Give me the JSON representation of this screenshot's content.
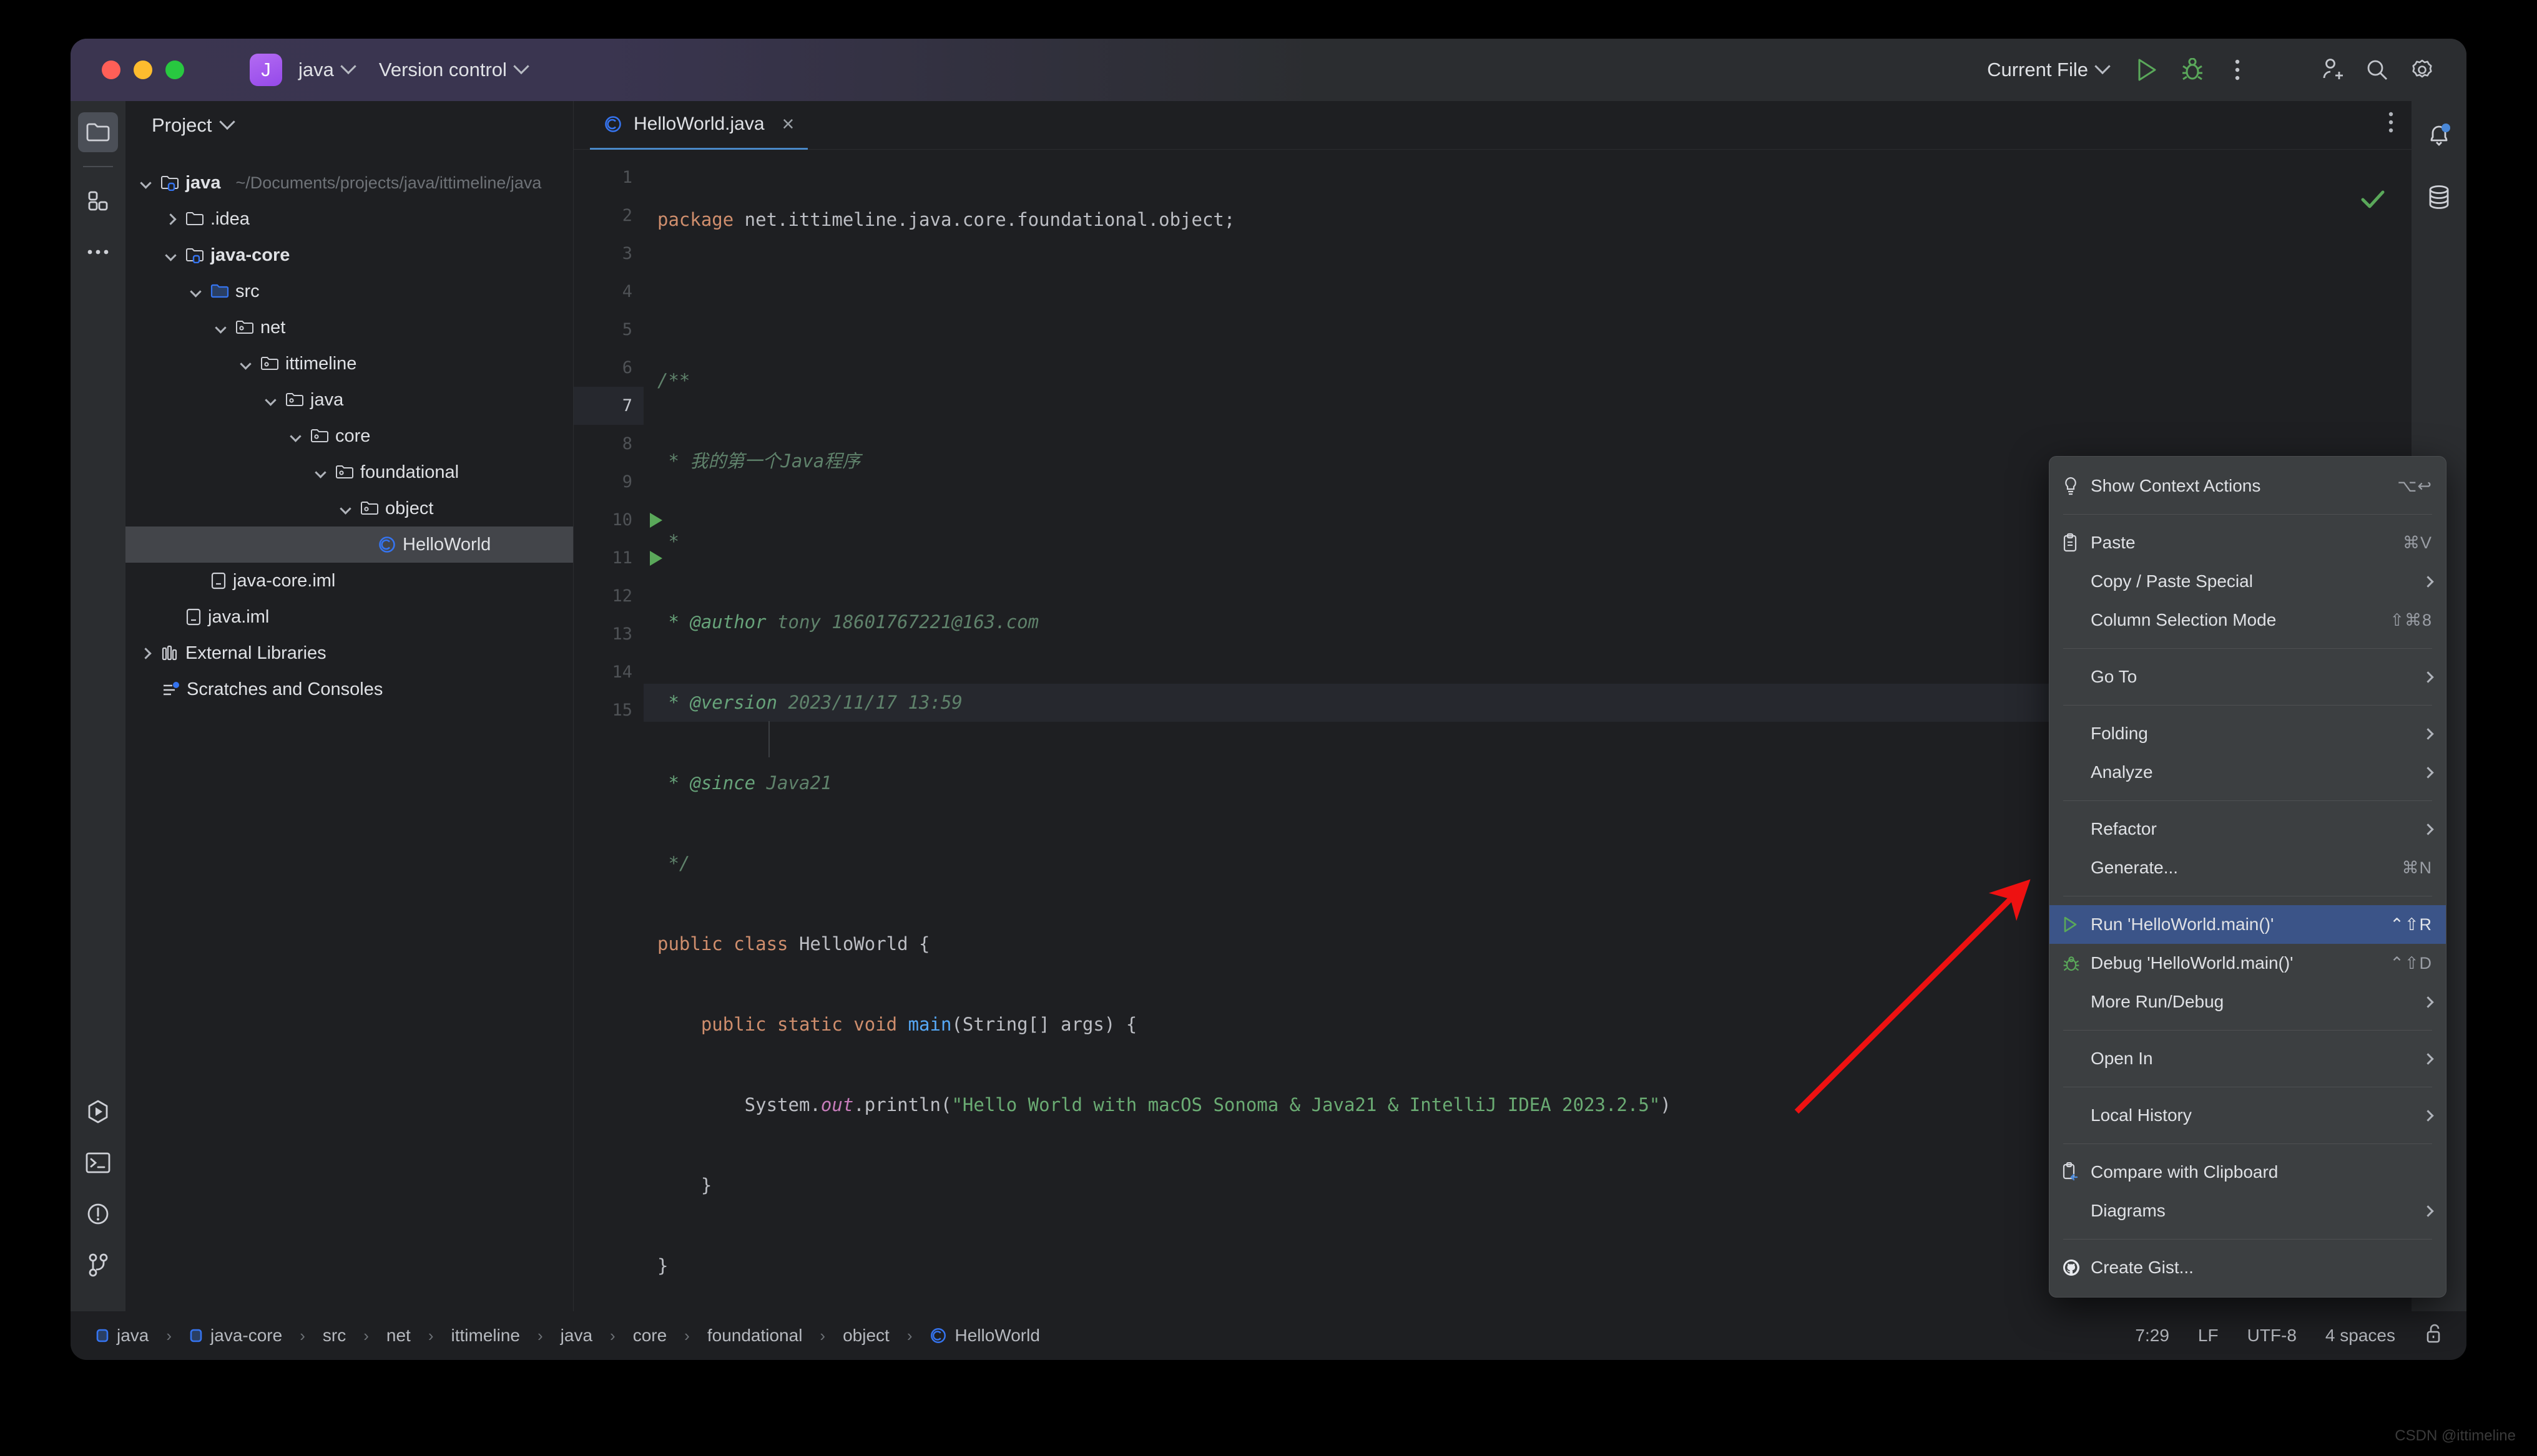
{
  "window": {
    "project_initial": "J",
    "project_name": "java",
    "vcs_label": "Version control",
    "run_config": "Current File"
  },
  "titlebar_icons": [
    {
      "name": "run-button",
      "glyph": "run"
    },
    {
      "name": "debug-button",
      "glyph": "bug"
    },
    {
      "name": "more-actions-button",
      "glyph": "kebab"
    },
    {
      "name": "add-collaborator-button",
      "glyph": "person-add"
    },
    {
      "name": "search-everywhere-button",
      "glyph": "search"
    },
    {
      "name": "settings-button",
      "glyph": "gear"
    }
  ],
  "left_rail": [
    {
      "name": "project-tool-window",
      "glyph": "folder",
      "active": true
    },
    {
      "name": "structure-tool-window",
      "glyph": "blocks",
      "active": false
    },
    {
      "name": "more-tool-windows",
      "glyph": "dots",
      "active": false
    },
    {
      "name": "run-tool-window",
      "glyph": "run-hex",
      "active": false
    },
    {
      "name": "terminal-tool-window",
      "glyph": "terminal",
      "active": false
    },
    {
      "name": "problems-tool-window",
      "glyph": "warning",
      "active": false
    },
    {
      "name": "version-control-tool-window",
      "glyph": "branch",
      "active": false
    }
  ],
  "right_rail": [
    {
      "name": "notifications-tool-window",
      "glyph": "bell",
      "badge": true
    },
    {
      "name": "database-tool-window",
      "glyph": "database",
      "badge": false
    }
  ],
  "project_panel": {
    "title": "Project",
    "tree": [
      {
        "label": "java",
        "path": "~/Documents/projects/java/ittimeline/java",
        "indent": 0,
        "arrow": "down",
        "icon": "module-folder",
        "bold": true,
        "selected": false
      },
      {
        "label": ".idea",
        "path": "",
        "indent": 1,
        "arrow": "right",
        "icon": "folder",
        "bold": false,
        "selected": false
      },
      {
        "label": "java-core",
        "path": "",
        "indent": 1,
        "arrow": "down",
        "icon": "module-folder",
        "bold": true,
        "selected": false
      },
      {
        "label": "src",
        "path": "",
        "indent": 2,
        "arrow": "down",
        "icon": "source-folder",
        "bold": false,
        "selected": false
      },
      {
        "label": "net",
        "path": "",
        "indent": 3,
        "arrow": "down",
        "icon": "package",
        "bold": false,
        "selected": false
      },
      {
        "label": "ittimeline",
        "path": "",
        "indent": 4,
        "arrow": "down",
        "icon": "package",
        "bold": false,
        "selected": false
      },
      {
        "label": "java",
        "path": "",
        "indent": 5,
        "arrow": "down",
        "icon": "package",
        "bold": false,
        "selected": false
      },
      {
        "label": "core",
        "path": "",
        "indent": 6,
        "arrow": "down",
        "icon": "package",
        "bold": false,
        "selected": false
      },
      {
        "label": "foundational",
        "path": "",
        "indent": 7,
        "arrow": "down",
        "icon": "package",
        "bold": false,
        "selected": false
      },
      {
        "label": "object",
        "path": "",
        "indent": 8,
        "arrow": "down",
        "icon": "package",
        "bold": false,
        "selected": false
      },
      {
        "label": "HelloWorld",
        "path": "",
        "indent": 9,
        "arrow": "none",
        "icon": "java-class",
        "bold": false,
        "selected": true
      },
      {
        "label": "java-core.iml",
        "path": "",
        "indent": 2,
        "arrow": "none",
        "icon": "iml-file",
        "bold": false,
        "selected": false
      },
      {
        "label": "java.iml",
        "path": "",
        "indent": 1,
        "arrow": "none",
        "icon": "iml-file",
        "bold": false,
        "selected": false
      },
      {
        "label": "External Libraries",
        "path": "",
        "indent": 0,
        "arrow": "right",
        "icon": "libraries",
        "bold": false,
        "selected": false
      },
      {
        "label": "Scratches and Consoles",
        "path": "",
        "indent": 0,
        "arrow": "none",
        "icon": "scratches",
        "bold": false,
        "selected": false
      }
    ]
  },
  "editor": {
    "tab_label": "HelloWorld.java",
    "tab_icon": "java-class",
    "close_label": "×",
    "inspection_status": "ok",
    "current_line": 7,
    "lines": [
      {
        "n": 1,
        "run": false
      },
      {
        "n": 2,
        "run": false
      },
      {
        "n": 3,
        "run": false
      },
      {
        "n": 4,
        "run": false
      },
      {
        "n": 5,
        "run": false
      },
      {
        "n": 6,
        "run": false
      },
      {
        "n": 7,
        "run": false
      },
      {
        "n": 8,
        "run": false
      },
      {
        "n": 9,
        "run": false
      },
      {
        "n": 10,
        "run": true
      },
      {
        "n": 11,
        "run": true
      },
      {
        "n": 12,
        "run": false
      },
      {
        "n": 13,
        "run": false
      },
      {
        "n": 14,
        "run": false
      },
      {
        "n": 15,
        "run": false
      }
    ],
    "code_text": {
      "l1_kw": "package",
      "l1_rest": " net.ittimeline.java.core.foundational.object;",
      "l3": "/**",
      "l4": " * 我的第一个Java程序",
      "l5": " *",
      "l6_tag": " * @author",
      "l6_rest": " tony 18601767221@163.com",
      "l7_tag": " * @version",
      "l7_rest": " 2023/11/17 13:59",
      "l8_tag": " * @since",
      "l8_rest": " Java21",
      "l9": " */",
      "l10_kw1": "public class",
      "l10_rest": " HelloWorld {",
      "l11_kw": "    public static void ",
      "l11_fn": "main",
      "l11_rest": "(String[] args) {",
      "l12_a": "        System.",
      "l12_fld": "out",
      "l12_b": ".println(",
      "l12_str": "\"Hello World with macOS Sonoma & Java21 & IntelliJ IDEA 2023.2.5\"",
      "l12_c": ")",
      "l13": "    }",
      "l14": "}"
    }
  },
  "context_menu": {
    "items": [
      {
        "label": "Show Context Actions",
        "accel": "⌥↩",
        "icon": "lightbulb-icon",
        "submenu": false,
        "highlighted": false
      },
      {
        "sep": true
      },
      {
        "label": "Paste",
        "accel": "⌘V",
        "icon": "clipboard-icon",
        "submenu": false,
        "highlighted": false
      },
      {
        "label": "Copy / Paste Special",
        "accel": "",
        "icon": "",
        "submenu": true,
        "highlighted": false
      },
      {
        "label": "Column Selection Mode",
        "accel": "⇧⌘8",
        "icon": "",
        "submenu": false,
        "highlighted": false
      },
      {
        "sep": true
      },
      {
        "label": "Go To",
        "accel": "",
        "icon": "",
        "submenu": true,
        "highlighted": false
      },
      {
        "sep": true
      },
      {
        "label": "Folding",
        "accel": "",
        "icon": "",
        "submenu": true,
        "highlighted": false
      },
      {
        "label": "Analyze",
        "accel": "",
        "icon": "",
        "submenu": true,
        "highlighted": false
      },
      {
        "sep": true
      },
      {
        "label": "Refactor",
        "accel": "",
        "icon": "",
        "submenu": true,
        "highlighted": false
      },
      {
        "label": "Generate...",
        "accel": "⌘N",
        "icon": "",
        "submenu": false,
        "highlighted": false
      },
      {
        "sep": true
      },
      {
        "label": "Run 'HelloWorld.main()'",
        "accel": "⌃⇧R",
        "icon": "run-icon",
        "submenu": false,
        "highlighted": true
      },
      {
        "label": "Debug 'HelloWorld.main()'",
        "accel": "⌃⇧D",
        "icon": "bug-icon",
        "submenu": false,
        "highlighted": false
      },
      {
        "label": "More Run/Debug",
        "accel": "",
        "icon": "",
        "submenu": true,
        "highlighted": false
      },
      {
        "sep": true
      },
      {
        "label": "Open In",
        "accel": "",
        "icon": "",
        "submenu": true,
        "highlighted": false
      },
      {
        "sep": true
      },
      {
        "label": "Local History",
        "accel": "",
        "icon": "",
        "submenu": true,
        "highlighted": false
      },
      {
        "sep": true
      },
      {
        "label": "Compare with Clipboard",
        "accel": "",
        "icon": "compare-icon",
        "submenu": false,
        "highlighted": false
      },
      {
        "label": "Diagrams",
        "accel": "",
        "icon": "",
        "submenu": true,
        "highlighted": false
      },
      {
        "sep": true
      },
      {
        "label": "Create Gist...",
        "accel": "",
        "icon": "github-icon",
        "submenu": false,
        "highlighted": false
      }
    ]
  },
  "statusbar": {
    "breadcrumb": [
      {
        "label": "java",
        "icon": "module-icon"
      },
      {
        "label": "java-core",
        "icon": "module-icon"
      },
      {
        "label": "src",
        "icon": ""
      },
      {
        "label": "net",
        "icon": ""
      },
      {
        "label": "ittimeline",
        "icon": ""
      },
      {
        "label": "java",
        "icon": ""
      },
      {
        "label": "core",
        "icon": ""
      },
      {
        "label": "foundational",
        "icon": ""
      },
      {
        "label": "object",
        "icon": ""
      },
      {
        "label": "HelloWorld",
        "icon": "java-class"
      }
    ],
    "separator": "›",
    "caret_position": "7:29",
    "line_separator": "LF",
    "encoding": "UTF-8",
    "indent": "4 spaces",
    "lock_icon": "unlocked-icon"
  },
  "annotation": {
    "arrow_color": "#ee1111",
    "watermark": "CSDN @ittimeline"
  },
  "colors": {
    "accent_blue": "#4a88d8",
    "highlight_blue": "#3b5488",
    "menu_bg": "#3c3f41",
    "panel_bg": "#1e1f22",
    "rail_bg": "#2b2d30",
    "green": "#5aa85a"
  }
}
